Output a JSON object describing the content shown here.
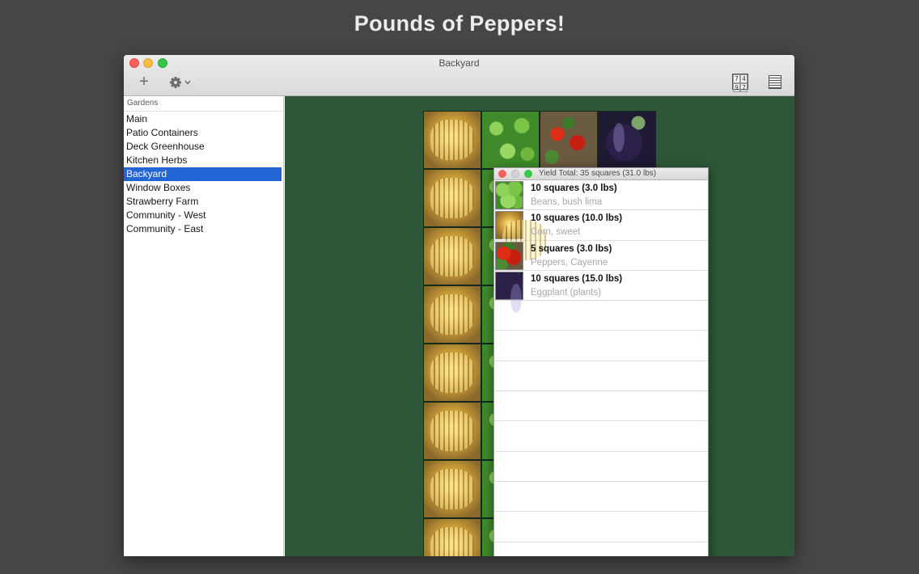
{
  "headline": "Pounds of Peppers!",
  "window": {
    "title": "Backyard",
    "toolbar": {
      "add_label": "+",
      "add_icon": "plus-icon",
      "gear_icon": "gear-icon",
      "grid_icon": "number-grid-icon",
      "grid_digits": [
        "7",
        "4",
        "9",
        "7"
      ],
      "list_icon": "list-view-icon"
    }
  },
  "sidebar": {
    "header": "Gardens",
    "items": [
      {
        "label": "Main",
        "selected": false
      },
      {
        "label": "Patio Containers",
        "selected": false
      },
      {
        "label": "Deck Greenhouse",
        "selected": false
      },
      {
        "label": "Kitchen Herbs",
        "selected": false
      },
      {
        "label": "Backyard",
        "selected": true
      },
      {
        "label": "Window Boxes",
        "selected": false
      },
      {
        "label": "Strawberry Farm",
        "selected": false
      },
      {
        "label": "Community - West",
        "selected": false
      },
      {
        "label": "Community - East",
        "selected": false
      }
    ]
  },
  "garden_grid": {
    "columns": 4,
    "rows": 8,
    "cells": [
      "corn",
      "bean",
      "pepper",
      "eggplant",
      "corn",
      "bean",
      "pepper",
      "eggplant",
      "corn",
      "bean",
      "pepper",
      "eggplant",
      "corn",
      "bean",
      "pepper",
      "eggplant",
      "corn",
      "bean",
      "pepper",
      "eggplant",
      "corn",
      "bean",
      "soil",
      "eggplant",
      "corn",
      "bean",
      "soil",
      "eggplant",
      "corn",
      "bean",
      "soil",
      "eggplant"
    ]
  },
  "yield_panel": {
    "title": "Yield Total: 35 squares (31.0 lbs)",
    "empty_rows": 9,
    "rows": [
      {
        "quantity": "10 squares (3.0 lbs)",
        "crop": "Beans, bush lima",
        "thumb": "bean"
      },
      {
        "quantity": "10 squares (10.0 lbs)",
        "crop": "Corn, sweet",
        "thumb": "corn"
      },
      {
        "quantity": "5 squares (3.0 lbs)",
        "crop": "Peppers, Cayenne",
        "thumb": "pepper"
      },
      {
        "quantity": "10 squares (15.0 lbs)",
        "crop": "Eggplant (plants)",
        "thumb": "eggplant"
      }
    ]
  },
  "colors": {
    "canvas_bg": "#2d5738",
    "selection": "#2465d6",
    "page_bg": "#474647"
  }
}
